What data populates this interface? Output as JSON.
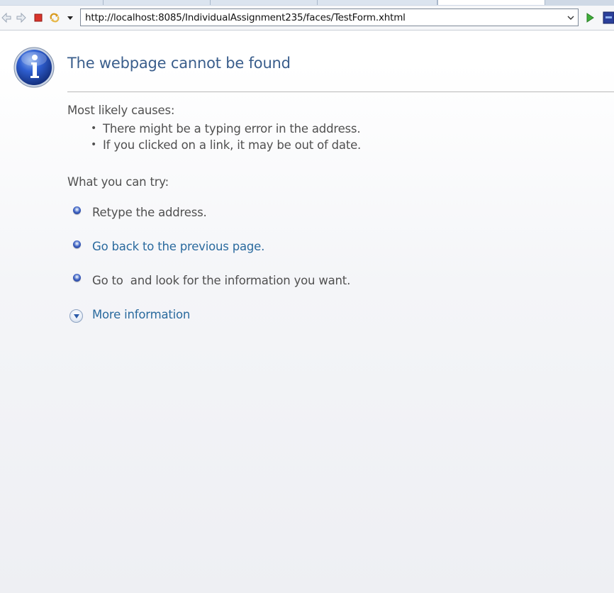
{
  "browser": {
    "url": "http://localhost:8085/IndividualAssignment235/faces/TestForm.xhtml"
  },
  "page": {
    "title": "The webpage cannot be found",
    "causes_heading": "Most likely causes:",
    "causes": [
      "There might be a typing error in the address.",
      "If you clicked on a link, it may be out of date."
    ],
    "try_heading": "What you can try:",
    "try_items": [
      "Retype the address.",
      "Go back to the previous page.",
      "Go to  and look for the information you want."
    ],
    "more_info": "More information"
  },
  "colors": {
    "title": "#3a5e8c",
    "link": "#2a6a9e",
    "text": "#505050"
  },
  "icons": {
    "back": "back-arrow-icon",
    "forward": "forward-arrow-icon",
    "stop": "stop-icon",
    "refresh": "refresh-icon",
    "menu": "chevron-down-icon",
    "go": "go-arrow-icon",
    "info": "info-icon",
    "expand": "expand-circle-icon"
  }
}
